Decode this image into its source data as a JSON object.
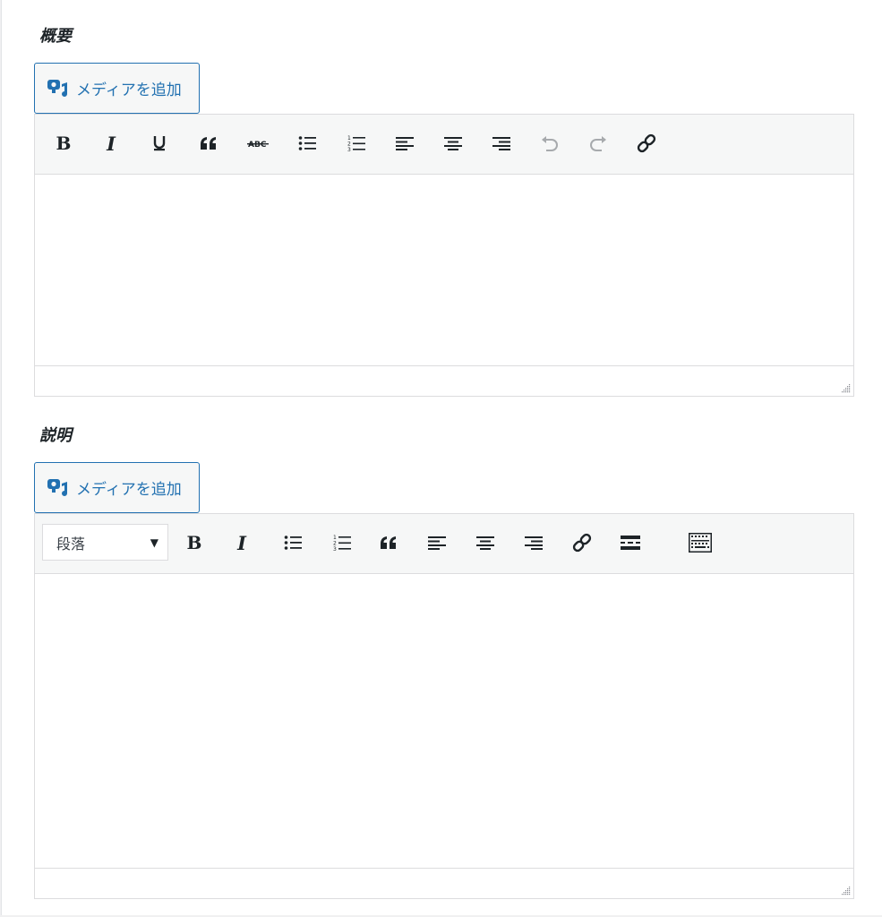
{
  "sections": [
    {
      "title": "概要",
      "media_button_label": "メディアを追加",
      "toolbar_buttons": [
        "bold-icon",
        "italic-icon",
        "underline-icon",
        "blockquote-icon",
        "strikethrough-icon",
        "bullet-list-icon",
        "numbered-list-icon",
        "align-left-icon",
        "align-center-icon",
        "align-right-icon",
        "undo-icon",
        "redo-icon",
        "link-icon"
      ],
      "bold_glyph": "B",
      "italic_glyph": "I",
      "quote_glyph": "❝"
    },
    {
      "title": "説明",
      "media_button_label": "メディアを追加",
      "format_select_value": "段落",
      "toolbar_buttons": [
        "format-select",
        "bold-icon",
        "italic-icon",
        "bullet-list-icon",
        "numbered-list-icon",
        "blockquote-icon",
        "align-left-icon",
        "align-center-icon",
        "align-right-icon",
        "link-icon",
        "read-more-icon",
        "toolbar-toggle-icon"
      ],
      "bold_glyph": "B",
      "italic_glyph": "I",
      "quote_glyph": "❝"
    }
  ],
  "colors": {
    "accent": "#2271b1",
    "toolbar_bg": "#f6f7f7",
    "border": "#dcdcde",
    "disabled_icon": "#a7aaad"
  }
}
